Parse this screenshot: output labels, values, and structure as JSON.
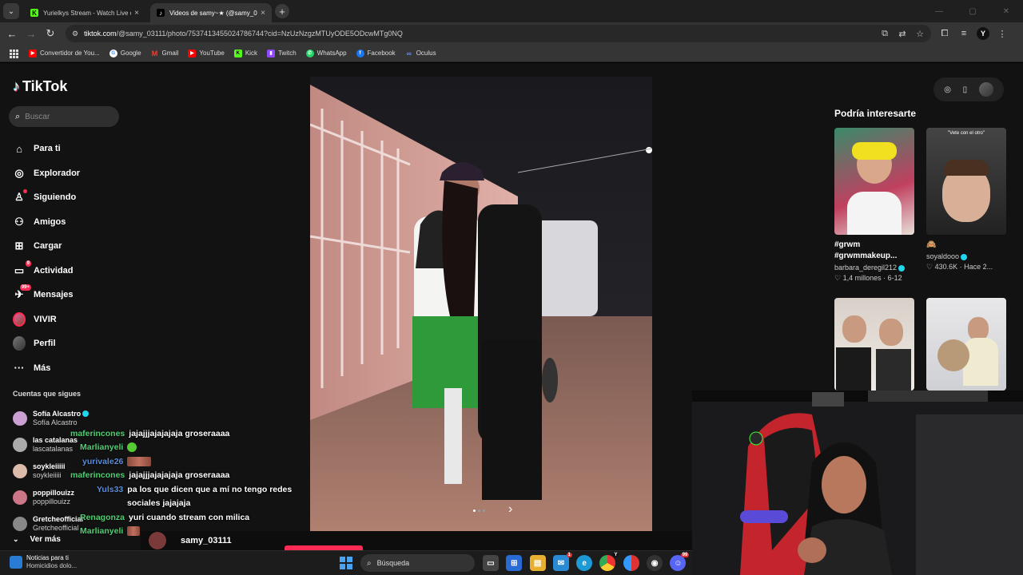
{
  "tabs": [
    {
      "title": "Yurielkys Stream - Watch Live o",
      "close": "×",
      "fav_text": "K",
      "fav_color": "#53fc18",
      "active": false
    },
    {
      "title": "Videos de samy~★ (@samy_03",
      "close": "×",
      "fav_text": "♪",
      "fav_color": "#000000",
      "active": true
    }
  ],
  "new_tab": "+",
  "address": {
    "host": "tiktok.com",
    "path": "/@samy_03111/photo/7537413455024786744?cid=NzUzNzgzMTUyODE5ODcwMTg0NQ"
  },
  "profile_initial": "Y",
  "bookmarks": [
    {
      "label": "Convertidor de You...",
      "icon": "youtube-icon",
      "color": "#ff0000"
    },
    {
      "label": "Google",
      "icon": "google-icon",
      "color": "#4285f4"
    },
    {
      "label": "Gmail",
      "icon": "gmail-icon",
      "color": "#ea4335"
    },
    {
      "label": "YouTube",
      "icon": "youtube-icon",
      "color": "#ff0000"
    },
    {
      "label": "Kick",
      "icon": "kick-icon",
      "color": "#53fc18"
    },
    {
      "label": "Twitch",
      "icon": "twitch-icon",
      "color": "#9146ff"
    },
    {
      "label": "WhatsApp",
      "icon": "whatsapp-icon",
      "color": "#25d366"
    },
    {
      "label": "Facebook",
      "icon": "facebook-icon",
      "color": "#1877f2"
    },
    {
      "label": "Oculus",
      "icon": "oculus-icon",
      "color": "#5e8bff"
    }
  ],
  "brand": {
    "name": "TikTok"
  },
  "search": {
    "placeholder": "Buscar"
  },
  "nav": [
    {
      "label": "Para ti",
      "icon": "home-icon",
      "glyph": "⌂"
    },
    {
      "label": "Explorador",
      "icon": "compass-icon",
      "glyph": "◎"
    },
    {
      "label": "Siguiendo",
      "icon": "following-icon",
      "glyph": "♙"
    },
    {
      "label": "Amigos",
      "icon": "friends-icon",
      "glyph": "⚇"
    },
    {
      "label": "Cargar",
      "icon": "upload-icon",
      "glyph": "⊞"
    },
    {
      "label": "Actividad",
      "icon": "activity-icon",
      "glyph": "▭",
      "badge": "9"
    },
    {
      "label": "Mensajes",
      "icon": "messages-icon",
      "glyph": "✈",
      "badge": "99+"
    },
    {
      "label": "VIVIR",
      "icon": "live-icon",
      "glyph": ""
    },
    {
      "label": "Perfil",
      "icon": "profile-icon",
      "glyph": ""
    },
    {
      "label": "Más",
      "icon": "more-icon",
      "glyph": "···"
    }
  ],
  "following_header": "Cuentas que sigues",
  "following": [
    {
      "name": "Sofía Alcastro",
      "user": "Sofía Alcastro",
      "verified": true,
      "color": "#c9a0d0"
    },
    {
      "name": "las catalanas",
      "user": "lascatalanas",
      "verified": false,
      "color": "#aaaaaa"
    },
    {
      "name": "soykleiiiii",
      "user": "soykleiiiii",
      "verified": false,
      "color": "#ddbbaa"
    },
    {
      "name": "poppillouizz",
      "user": "poppillouizz",
      "verified": false,
      "color": "#cc7788"
    },
    {
      "name": "Gretcheofficial",
      "user": "Gretcheofficial",
      "verified": false,
      "color": "#888888"
    }
  ],
  "ver_mas": "Ver más",
  "ver_mas_icon": "⌄",
  "chat": [
    {
      "user": "maferincones",
      "color": "#4fcf70",
      "msg": "jajajjjajajajaja groseraaaa",
      "indent": 88
    },
    {
      "user": "Marlianyeli",
      "color": "#4fcf70",
      "msg": "",
      "emote": "green",
      "indent": 100
    },
    {
      "user": "yurivale26",
      "color": "#5b8bd9",
      "msg": "",
      "emote": "face",
      "indent": 103
    },
    {
      "user": "maferincones",
      "color": "#4fcf70",
      "msg": "jajajjjajajajaja groseraaaa",
      "indent": 88
    },
    {
      "user": "Yuls33",
      "color": "#5b8bd9",
      "msg": "pa los que dicen que a mí no tengo redes",
      "indent": 121
    },
    {
      "user": "",
      "color": "#ffffff",
      "msg": "sociales jajajaja",
      "indent": 154
    },
    {
      "user": "Renagonza",
      "color": "#4fcf70",
      "msg": "yuri cuando stream con milica",
      "indent": 100
    },
    {
      "user": "Marlianyeli",
      "color": "#4fcf70",
      "msg": "",
      "emote": "face",
      "indent": 100
    }
  ],
  "post": {
    "username": "samy_03111"
  },
  "carousel_next": "›",
  "recommend": {
    "title": "Podría interesarte",
    "items": [
      {
        "caption": "#grwm #grwmmakeup...",
        "user": "barbara_deregil212",
        "verified": true,
        "likes": "♡ 1,4 millones",
        "date": "6-12",
        "thumb_text": ""
      },
      {
        "caption": "🙈",
        "user": "soyaldooo",
        "verified": true,
        "likes": "♡ 430.6K",
        "date": "Hace 2...",
        "thumb_text": "\"Vete con el otro\""
      },
      {
        "caption": "",
        "user": "",
        "verified": false,
        "likes": "",
        "date": "",
        "thumb_text": ""
      },
      {
        "caption": "",
        "user": "",
        "verified": false,
        "likes": "",
        "date": "",
        "thumb_text": ""
      }
    ]
  },
  "taskbar": {
    "news_title": "Noticias para ti",
    "news_sub": "Homicidios dolo...",
    "search_placeholder": "Búsqueda",
    "apps": [
      {
        "name": "task-view-icon",
        "color": "#444444",
        "label": ""
      },
      {
        "name": "store-icon",
        "color": "#2a6ad4",
        "label": ""
      },
      {
        "name": "file-explorer-icon",
        "color": "#e8b030",
        "label": ""
      },
      {
        "name": "mail-icon",
        "color": "#2a8ad4",
        "label": "",
        "badge": "1"
      },
      {
        "name": "edge-icon",
        "color": "#1d9ad6",
        "label": ""
      },
      {
        "name": "chrome-icon",
        "color": "#2e9d47",
        "label": "",
        "badge": "Y"
      },
      {
        "name": "app-icon",
        "color": "#d63030",
        "label": ""
      },
      {
        "name": "obs-icon",
        "color": "#333333",
        "label": ""
      },
      {
        "name": "discord-icon",
        "color": "#5865f2",
        "label": "",
        "badge": "99"
      }
    ]
  }
}
